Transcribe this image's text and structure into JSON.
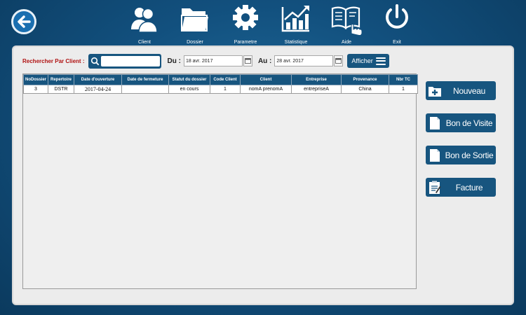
{
  "nav": {
    "items": [
      {
        "label": "Client",
        "icon": "client-icon"
      },
      {
        "label": "Dossier",
        "icon": "folder-icon"
      },
      {
        "label": "Parametre",
        "icon": "gear-icon"
      },
      {
        "label": "Statistique",
        "icon": "chart-icon"
      },
      {
        "label": "Aide",
        "icon": "book-hand-icon"
      },
      {
        "label": "Exit",
        "icon": "power-icon"
      }
    ]
  },
  "search": {
    "label": "Rechercher Par Client :",
    "value": "",
    "du_label": "Du :",
    "du_value": "18 avr. 2017",
    "au_label": "Au :",
    "au_value": "28 avr. 2017",
    "afficher_label": "Afficher"
  },
  "table": {
    "headers": [
      "NoDossier",
      "Repertoire",
      "Date d'ouverture",
      "Date de fermeture",
      "Statut du dossier",
      "Code Client",
      "Client",
      "Entreprise",
      "Provenance",
      "Nbr TC"
    ],
    "rows": [
      [
        "3",
        "DSTR",
        "2017-04-24",
        "",
        "en cours",
        "1",
        "nomA prenomA",
        "entrepriseA",
        "China",
        "1"
      ]
    ]
  },
  "actions": {
    "nouveau": "Nouveau",
    "bon_visite": "Bon de Visite",
    "bon_sortie": "Bon de Sortie",
    "facture": "Facture"
  },
  "colors": {
    "accent": "#17557f",
    "label_red": "#b01212",
    "background": "#12507e"
  }
}
